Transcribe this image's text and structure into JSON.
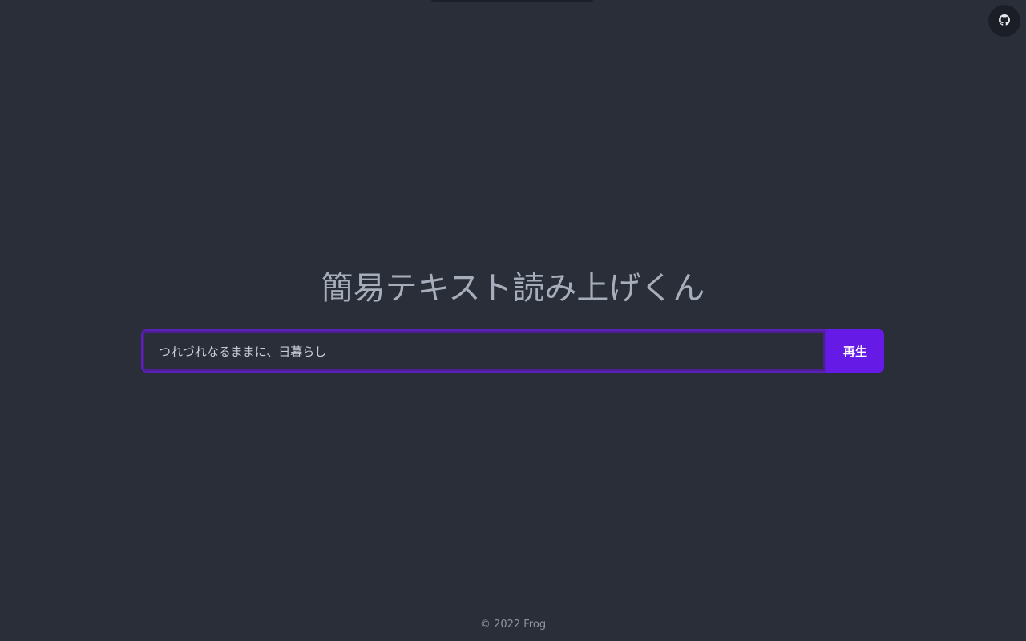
{
  "top_bar": {
    "progress_percent": 0
  },
  "header": {
    "github_icon": "github-icon"
  },
  "main": {
    "title": "簡易テキスト読み上げくん",
    "input_value": "つれづれなるままに、日暮らし",
    "play_label": "再生"
  },
  "footer": {
    "text": "© 2022 Frog"
  },
  "colors": {
    "background": "#2a2e39",
    "accent": "#661ae6",
    "title_text": "#a6adbb"
  }
}
